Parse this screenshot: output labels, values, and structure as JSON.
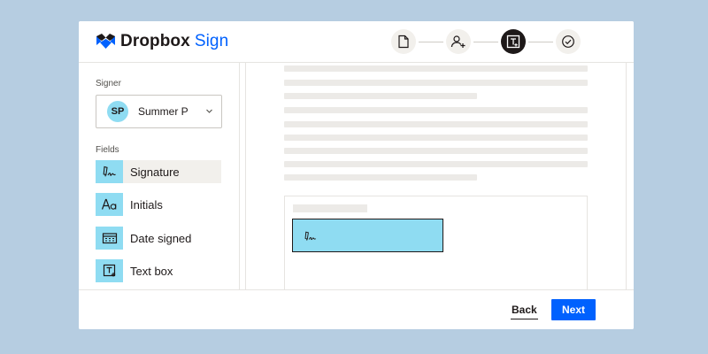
{
  "app": {
    "brand": "Dropbox",
    "product": "Sign",
    "logo_color": "#0061fe"
  },
  "steps": [
    {
      "icon": "document-icon",
      "active": false
    },
    {
      "icon": "add-signer-icon",
      "active": false
    },
    {
      "icon": "text-field-icon",
      "active": true
    },
    {
      "icon": "check-circle-icon",
      "active": false
    }
  ],
  "sidebar": {
    "signer_label": "Signer",
    "signer": {
      "initials": "SP",
      "name": "Summer P"
    },
    "fields_label": "Fields",
    "fields": [
      {
        "label": "Signature",
        "icon": "signature-icon",
        "selected": true
      },
      {
        "label": "Initials",
        "icon": "initials-icon",
        "selected": false
      },
      {
        "label": "Date signed",
        "icon": "calendar-icon",
        "selected": false
      },
      {
        "label": "Text box",
        "icon": "text-box-icon",
        "selected": false
      }
    ]
  },
  "document": {
    "placed_field": "signature-icon"
  },
  "footer": {
    "back_label": "Back",
    "next_label": "Next"
  },
  "colors": {
    "accent": "#0061fe",
    "field_fill": "#8fdcf2",
    "background": "#b6cde1"
  }
}
